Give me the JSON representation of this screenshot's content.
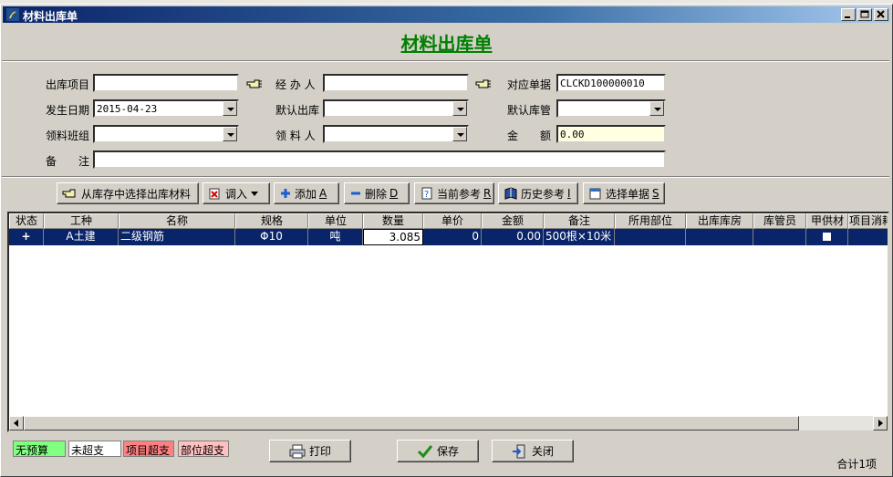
{
  "window": {
    "title": "材料出库单"
  },
  "header": {
    "title": "材料出库单"
  },
  "form": {
    "project": {
      "label": "出库项目",
      "value": ""
    },
    "handler": {
      "label": "经 办 人",
      "value": ""
    },
    "ref_doc": {
      "label": "对应单据",
      "value": "CLCKD100000010"
    },
    "date": {
      "label": "发生日期",
      "value": "2015-04-23"
    },
    "default_warehouse": {
      "label": "默认出库",
      "value": ""
    },
    "default_keeper": {
      "label": "默认库管",
      "value": ""
    },
    "team": {
      "label": "领料班组",
      "value": ""
    },
    "receiver": {
      "label": "领 料 人",
      "value": ""
    },
    "amount": {
      "label": "金　　额",
      "value": "0.00"
    },
    "remark": {
      "label": "备　　注",
      "value": ""
    }
  },
  "toolbar": {
    "select_from_stock": "从库存中选择出库材料",
    "import": "调入",
    "add": "添加",
    "add_key": "A",
    "delete": "删除",
    "delete_key": "D",
    "current_ref": "当前参考",
    "current_ref_key": "R",
    "history_ref": "历史参考",
    "history_ref_key": "I",
    "select_doc": "选择单据",
    "select_doc_key": "S"
  },
  "table": {
    "columns": [
      "状态",
      "工种",
      "名称",
      "规格",
      "单位",
      "数量",
      "单价",
      "金额",
      "备注",
      "所用部位",
      "出库库房",
      "库管员",
      "甲供材",
      "项目消耗"
    ],
    "rows": [
      {
        "status": "+",
        "trade": "A土建",
        "name": "二级钢筋",
        "spec": "Φ10",
        "unit": "吨",
        "qty": "3.085",
        "price": "0",
        "amount": "0.00",
        "remark": "500根×10米",
        "part": "",
        "warehouse": "",
        "keeper": "",
        "owner_supplied": false,
        "consume": ""
      }
    ]
  },
  "legend": {
    "no_budget": "无预算",
    "not_over": "未超支",
    "project_over": "项目超支",
    "part_over": "部位超支"
  },
  "buttons": {
    "print": "打印",
    "save": "保存",
    "close": "关闭"
  },
  "footer": {
    "total": "合计1项"
  },
  "colors": {
    "title_green": "#008000",
    "selection": "#0a246a",
    "no_budget": "#80ff80",
    "project_over": "#ff8080",
    "part_over": "#ffc0c0"
  }
}
